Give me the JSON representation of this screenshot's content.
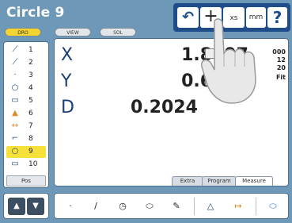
{
  "title": "Circle 9",
  "pills": {
    "dro": "DRO",
    "view": "VIEW",
    "sol": "SOL"
  },
  "toolbar": {
    "undo": "↶",
    "plus": "+",
    "xs": "xs",
    "mm": "mm",
    "help": "?"
  },
  "features": [
    {
      "icon": "⟋",
      "num": "1"
    },
    {
      "icon": "⟋",
      "num": "2"
    },
    {
      "icon": "·",
      "num": "3"
    },
    {
      "icon": "○",
      "num": "4"
    },
    {
      "icon": "▭",
      "num": "5"
    },
    {
      "icon": "▲",
      "num": "6"
    },
    {
      "icon": "↔",
      "num": "7"
    },
    {
      "icon": "⌐",
      "num": "8"
    },
    {
      "icon": "○",
      "num": "9"
    },
    {
      "icon": "▭",
      "num": "10"
    }
  ],
  "selected_feature": "9",
  "pos_label": "Pos",
  "readout": {
    "x_label": "X",
    "x_value": "1.8997",
    "y_label": "Y",
    "y_value": "0.6906",
    "d_label": "D",
    "d_value": "0.2024"
  },
  "side_info": [
    "000",
    "12",
    "20",
    "Fit"
  ],
  "tabs": {
    "extra": "Extra",
    "program": "Program",
    "measure": "Measure"
  },
  "arrows": {
    "up": "▲",
    "down": "▼"
  },
  "measure_tools": {
    "point": "·",
    "line": "/",
    "circle": "◷",
    "slot": "⬭",
    "blob": "✎",
    "angle": "△",
    "distance": "↦",
    "skew": "⬭"
  },
  "colors": {
    "background": "#6e98b8",
    "toolbar": "#1f4d8a",
    "selected": "#f6e13a"
  }
}
